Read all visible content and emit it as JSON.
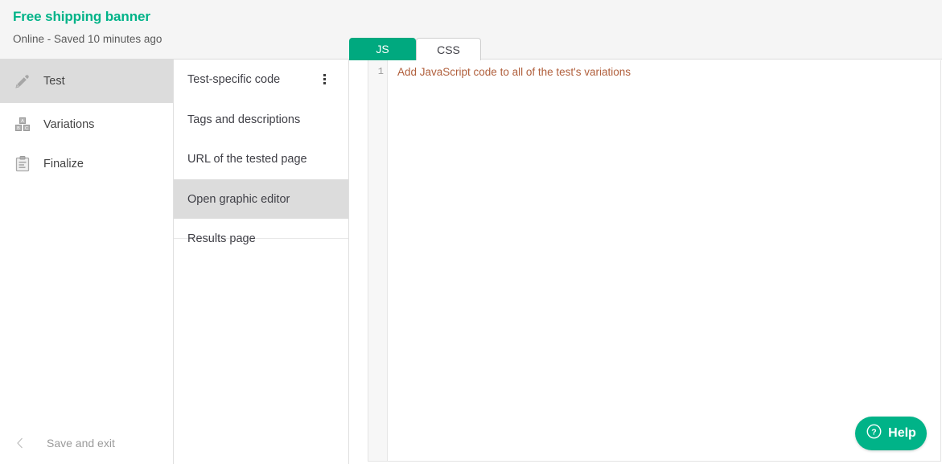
{
  "header": {
    "title": "Free shipping banner",
    "status": "Online - Saved 10 minutes ago",
    "accent_color": "#00b388"
  },
  "sidebar": {
    "items": [
      {
        "label": "Test",
        "icon": "pencil-icon",
        "active": true
      },
      {
        "label": "Variations",
        "icon": "abc-blocks-icon",
        "active": false
      },
      {
        "label": "Finalize",
        "icon": "clipboard-icon",
        "active": false
      }
    ],
    "footer": {
      "label": "Save and exit",
      "icon": "chevron-left-icon"
    }
  },
  "menu": {
    "items": [
      {
        "label": "Test-specific code",
        "active": false,
        "has_kebab": true
      },
      {
        "label": "Tags and descriptions",
        "active": false,
        "has_kebab": false
      },
      {
        "label": "URL of the tested page",
        "active": false,
        "has_kebab": false
      },
      {
        "label": "Open graphic editor",
        "active": true,
        "has_kebab": false
      },
      {
        "label": "Results page",
        "active": false,
        "has_kebab": false
      }
    ],
    "kebab_icon": "more-vertical-icon"
  },
  "editor": {
    "tabs": [
      {
        "label": "JS",
        "active": true
      },
      {
        "label": "CSS",
        "active": false
      }
    ],
    "active_tab_color": "#00a97f",
    "line_number": "1",
    "code_text": "Add JavaScript code to all of the test's variations",
    "code_text_color": "#b05f3c"
  },
  "help": {
    "label": "Help",
    "icon": "question-circle-icon",
    "color": "#00b388"
  }
}
